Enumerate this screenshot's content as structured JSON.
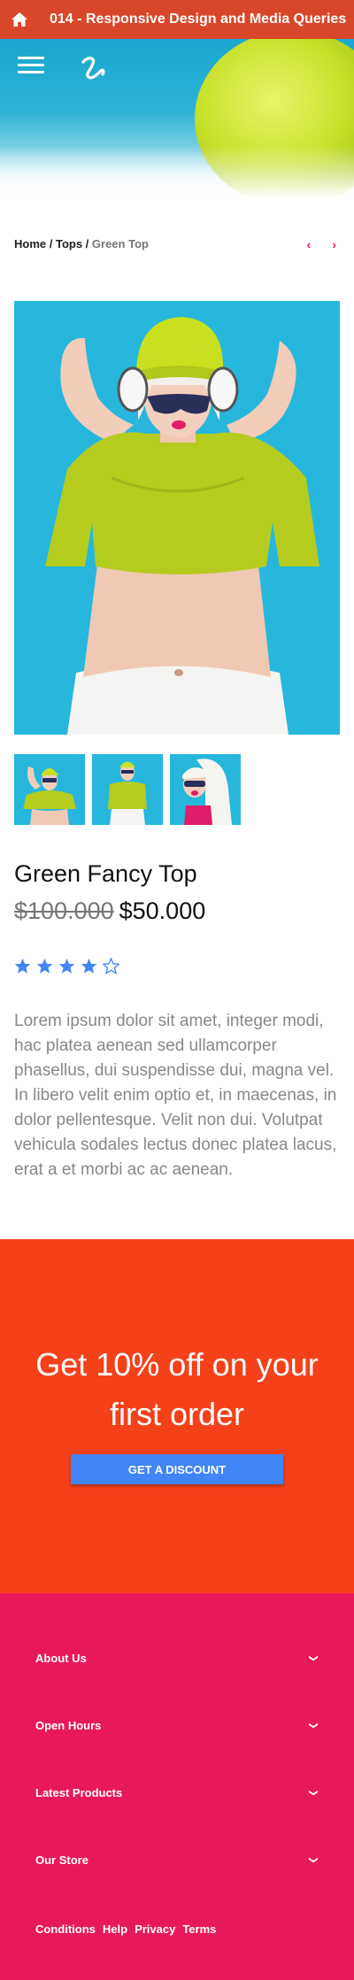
{
  "app": {
    "title": "014 - Responsive Design and Media Queries"
  },
  "icons": {
    "home": "home-icon",
    "menu": "hamburger-menu-icon",
    "logo": "logo-icon",
    "star_filled": "star-icon",
    "star_empty": "star-outline-icon",
    "chevron": "chevron-down-icon"
  },
  "colors": {
    "topbar": "#d9472a",
    "accent": "#e0195a",
    "promo": "#f4411a",
    "button": "#4285f4",
    "footer": "#e8195a",
    "star": "#4285f4"
  },
  "breadcrumb": {
    "home": "Home",
    "sep1": " / ",
    "tops": "Tops",
    "sep2": " / ",
    "current": "Green Top"
  },
  "nav_arrows": {
    "prev": "‹",
    "next": "›"
  },
  "product": {
    "name": "Green Fancy Top",
    "old_price": "$100.000",
    "price": "$50.000",
    "rating": 4,
    "rating_max": 5,
    "description": "Lorem ipsum dolor sit amet, integer modi, hac platea aenean sed ullamcorper phasellus, dui suspendisse dui, magna vel. In libero velit enim optio et, in maecenas, in dolor pellentesque. Velit non dui. Volutpat vehicula sodales lectus donec platea lacus, erat a et morbi ac ac aenean."
  },
  "promo": {
    "headline_line1": "Get 10% off on your",
    "headline_line2": "first order",
    "button": "GET A DISCOUNT"
  },
  "footer": {
    "sections": [
      "About Us",
      "Open Hours",
      "Latest Products",
      "Our Store"
    ],
    "links": [
      "Conditions",
      "Help",
      "Privacy",
      "Terms"
    ]
  }
}
